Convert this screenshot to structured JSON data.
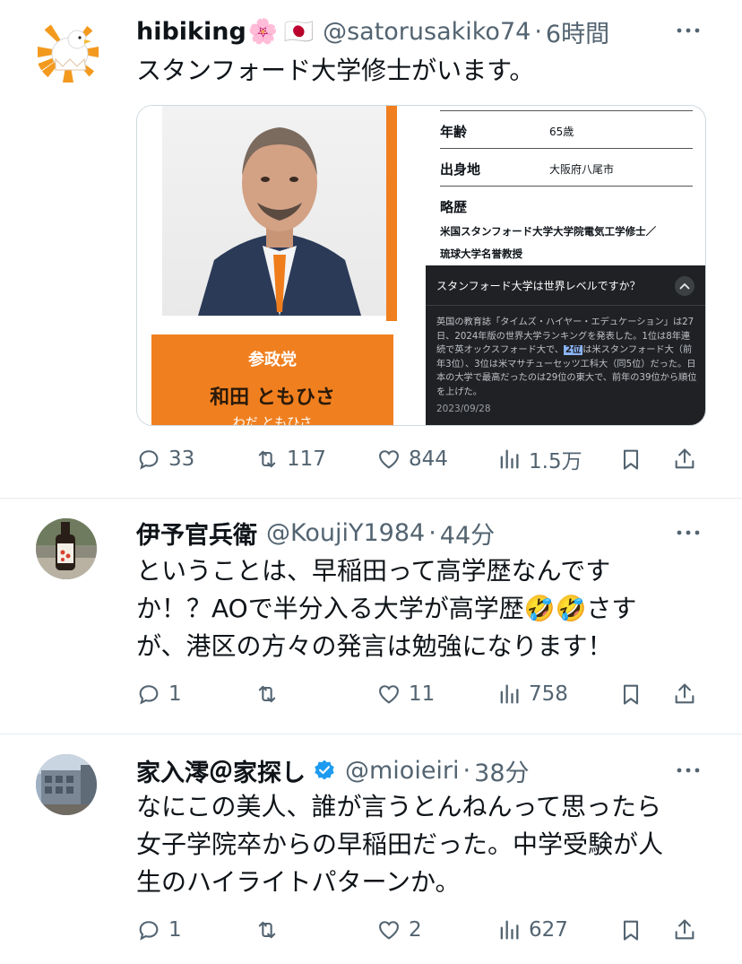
{
  "tweets": [
    {
      "name": "hibiking",
      "name_emoji_flower": "🌸",
      "name_emoji_flag": "🇯🇵",
      "handle": "@satorusakiko74",
      "time": "6時間",
      "text": "スタンフォード大学修士がいます。",
      "media": {
        "age_label": "年齢",
        "age_value": "65歳",
        "birthplace_label": "出身地",
        "birthplace_value": "大阪府八尾市",
        "bio_label": "略歴",
        "bio_line1": "米国スタンフォード大学大学院電気工学修士／",
        "bio_line2": "琉球大学名誉教授",
        "party_name": "参政党",
        "candidate_name": "和田 ともひさ",
        "candidate_kana": "わだ ともひさ",
        "panel_question": "スタンフォード大学は世界レベルですか？",
        "panel_text_before": "英国の教育誌「タイムズ・ハイヤー・エデュケーション」は27日、2024年版の世界大学ランキングを発表した。1位は8年連続で英オックスフォード大で、",
        "panel_highlight": "2位",
        "panel_text_after": "は米スタンフォード大（前年3位）、3位は米マサチューセッツ工科大（同5位）だった。日本の大学で最高だったのは29位の東大で、前年の39位から順位を上げた。",
        "panel_date": "2023/09/28"
      },
      "replies": "33",
      "retweets": "117",
      "likes": "844",
      "views": "1.5万"
    },
    {
      "name": "伊予官兵衛",
      "handle": "@KoujiY1984",
      "time": "44分",
      "text_line1": "ということは、早稲田って高学歴なんです",
      "text_line2": "か！？AOで半分入る大学が高学歴🤣🤣さす",
      "text_line3": "が、港区の方々の発言は勉強になります！",
      "replies": "1",
      "retweets": "",
      "likes": "11",
      "views": "758"
    },
    {
      "name": "家入澪＠家探し",
      "handle": "@mioieiri",
      "time": "38分",
      "text_line1": "なにこの美人、誰が言うとんねんって思ったら",
      "text_line2": "女子学院卒からの早稲田だった。中学受験が人",
      "text_line3": "生のハイライトパターンか。",
      "replies": "1",
      "retweets": "",
      "likes": "2",
      "views": "627"
    }
  ],
  "separator": "·",
  "colors": {
    "text": "#0f1419",
    "secondary": "#536471",
    "verified": "#1d9bf0",
    "orange": "#f07f1f"
  }
}
